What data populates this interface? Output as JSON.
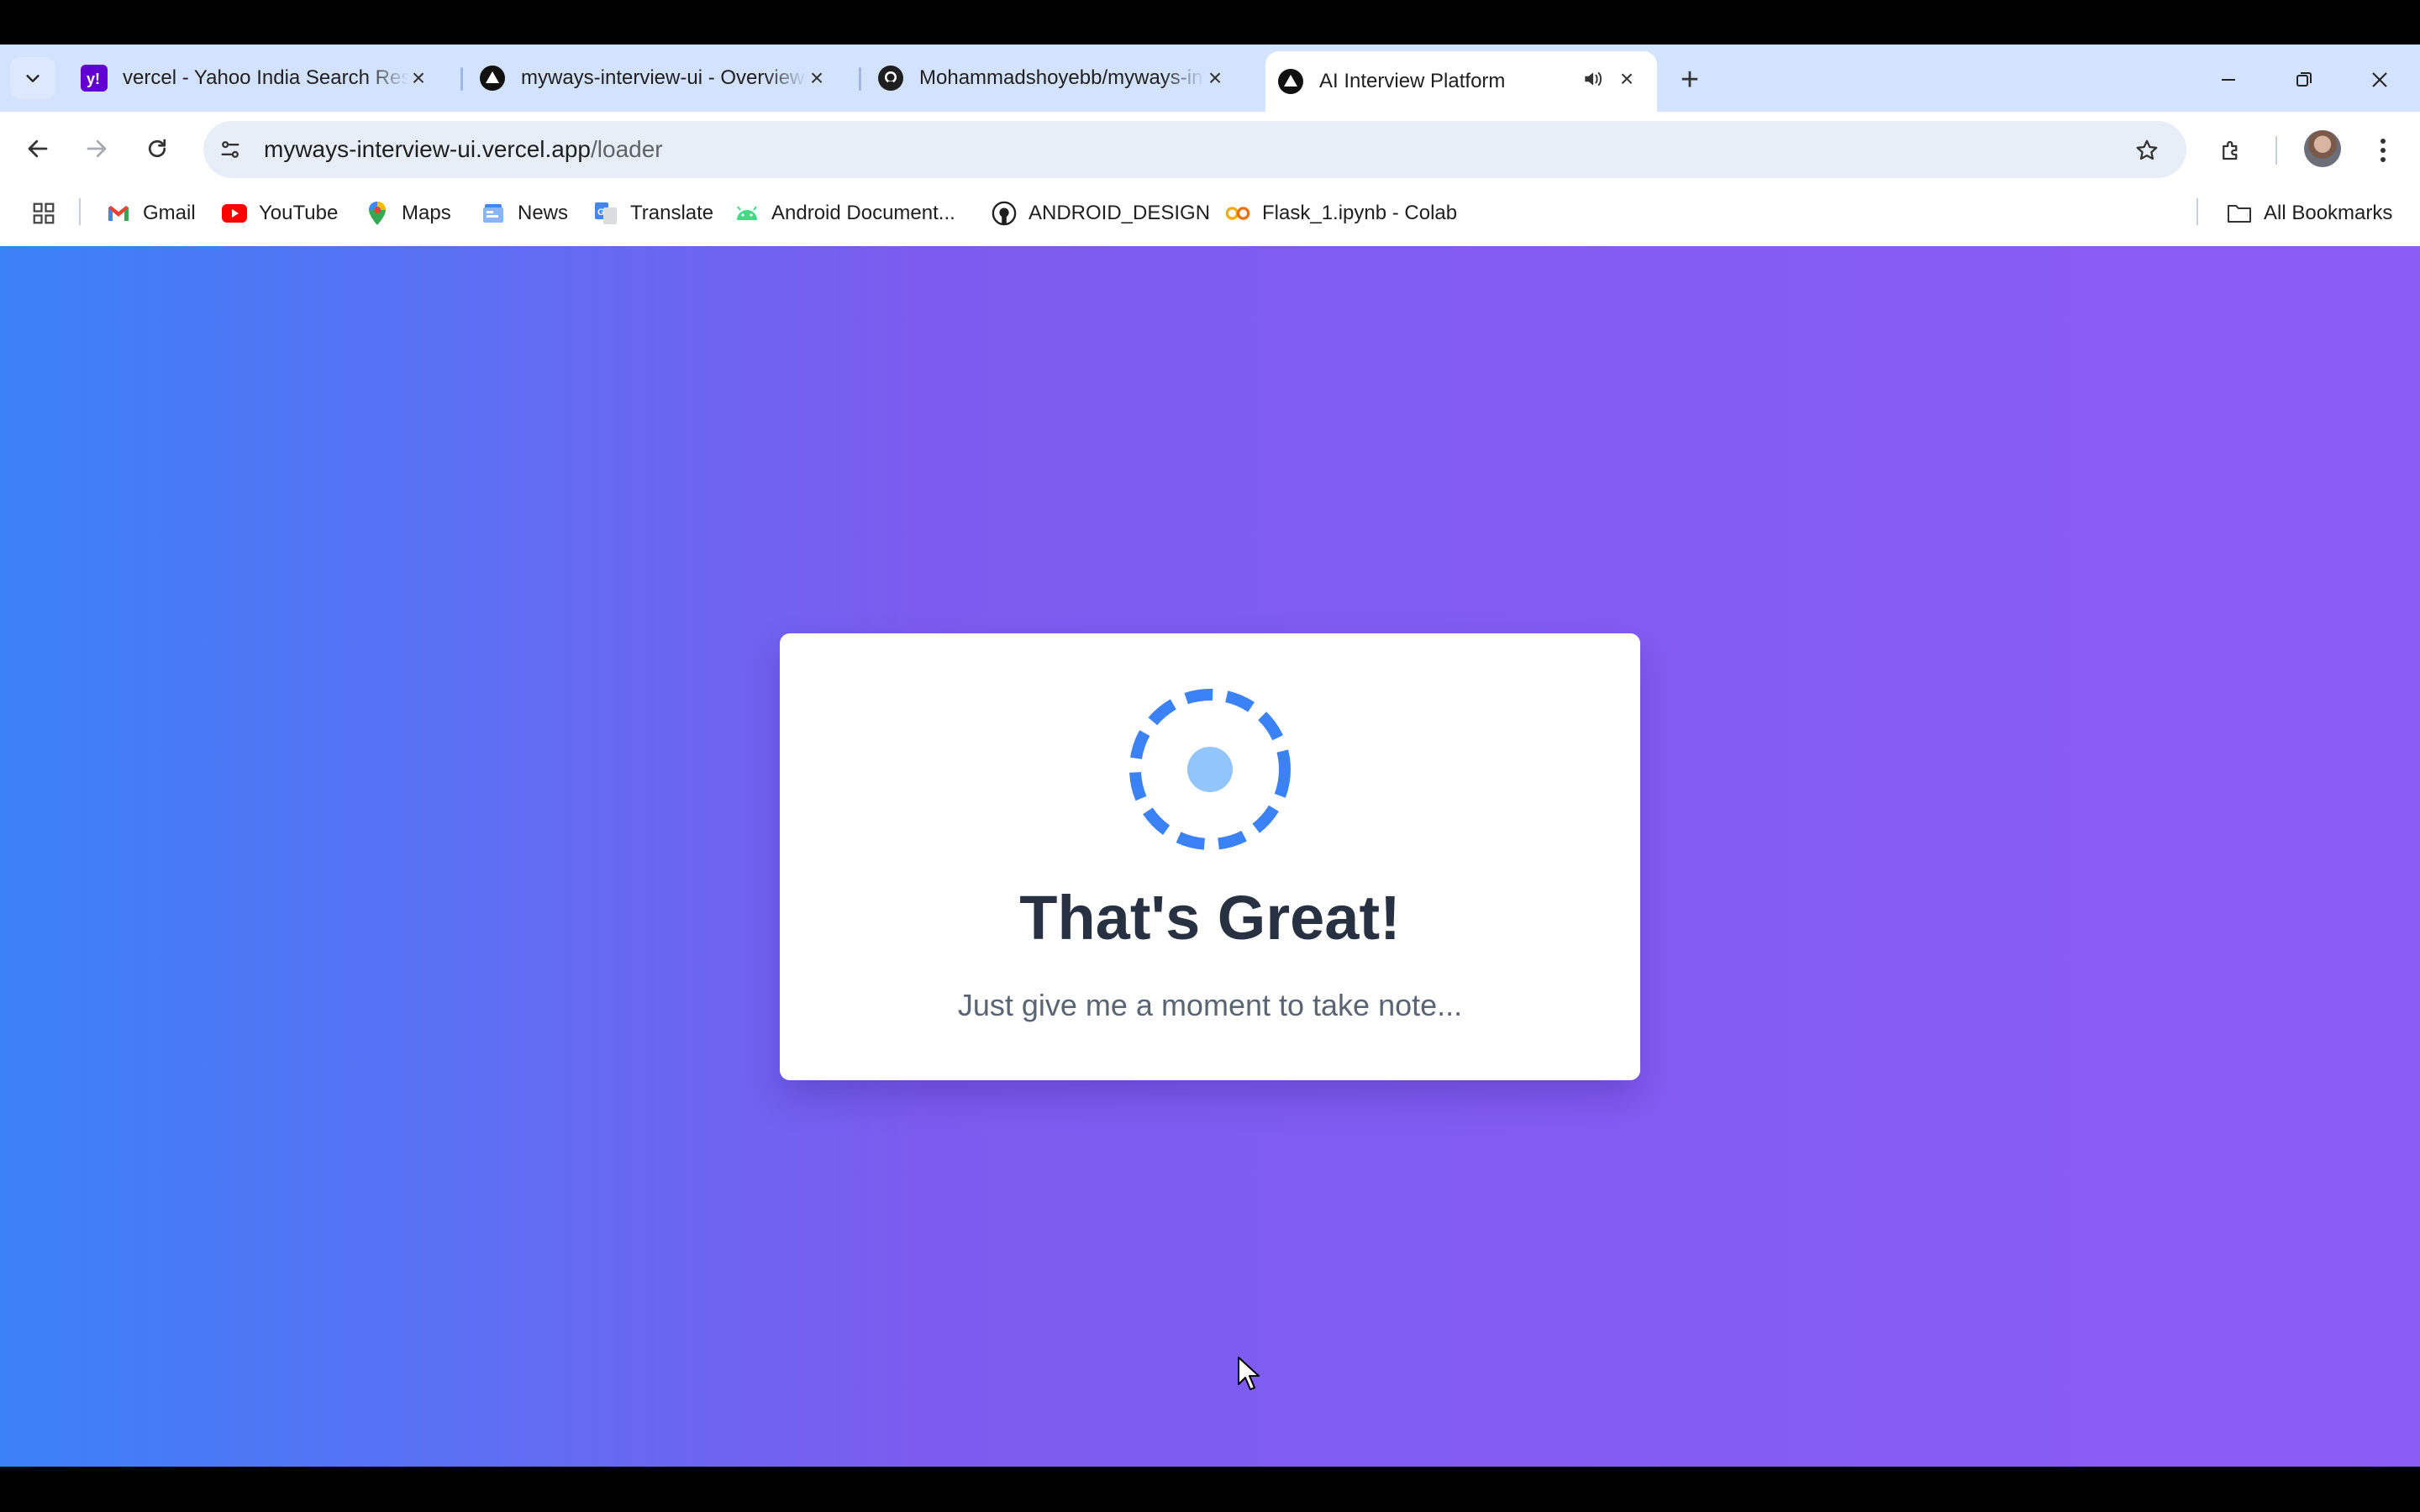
{
  "browser": {
    "tabs": [
      {
        "title": "vercel - Yahoo India Search Results",
        "icon": "yahoo-icon",
        "active": false
      },
      {
        "title": "myways-interview-ui - Overview",
        "icon": "vercel-icon",
        "active": false
      },
      {
        "title": "Mohammadshoyebb/myways-interview-ui",
        "icon": "github-icon",
        "active": false
      },
      {
        "title": "AI Interview Platform",
        "icon": "vercel-icon",
        "active": true
      }
    ],
    "url_host": "myways-interview-ui.vercel.app",
    "url_path": "/loader",
    "bookmarks": [
      {
        "label": "Gmail",
        "icon": "gmail-icon"
      },
      {
        "label": "YouTube",
        "icon": "youtube-icon"
      },
      {
        "label": "Maps",
        "icon": "maps-icon"
      },
      {
        "label": "News",
        "icon": "news-icon"
      },
      {
        "label": "Translate",
        "icon": "translate-icon"
      },
      {
        "label": "Android Document...",
        "icon": "android-icon"
      },
      {
        "label": "ANDROID_DESIGN",
        "icon": "github-icon"
      },
      {
        "label": "Flask_1.ipynb - Colab",
        "icon": "colab-icon"
      }
    ],
    "all_bookmarks": "All Bookmarks"
  },
  "page": {
    "headline": "That's Great!",
    "subtext": "Just give me a moment to take note..."
  },
  "colors": {
    "gradient_start": "#3b82f6",
    "gradient_end": "#8b5cf6",
    "spinner": "#3b82f6",
    "headline": "#283142"
  }
}
